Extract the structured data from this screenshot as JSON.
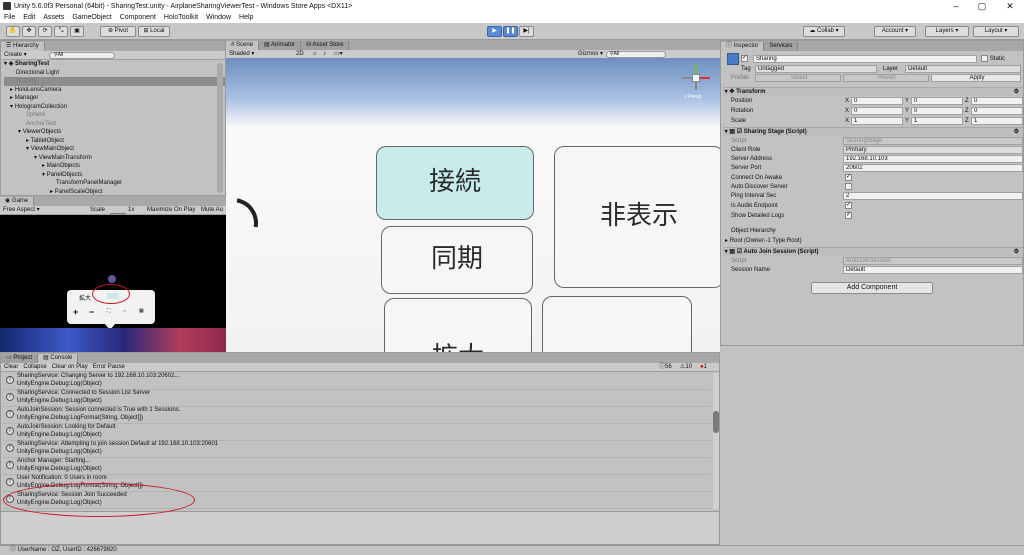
{
  "window": {
    "title": "Unity 5.6.0f3 Personal (64bit) - SharingTest.unity - AirplaneSharingViewerTest - Windows Store Apps <DX11>"
  },
  "menu": [
    "File",
    "Edit",
    "Assets",
    "GameObject",
    "Component",
    "HoloToolkit",
    "Window",
    "Help"
  ],
  "toolbar": {
    "pivot": "Pivot",
    "local": "Local",
    "collab": "Collab",
    "account": "Account",
    "layers": "Layers",
    "layout": "Layout"
  },
  "hierarchy": {
    "tab": "Hierarchy",
    "create": "Create",
    "search": "All",
    "scene": "SharingTest",
    "items": [
      {
        "label": "Directional Light",
        "grey": false
      },
      {
        "label": "Sharing",
        "grey": true
      },
      {
        "label": "HoloLensCamera",
        "grey": false
      },
      {
        "label": "Manager",
        "grey": false
      },
      {
        "label": "HologramCollection",
        "grey": false
      },
      {
        "label": "Sphere",
        "grey": true
      },
      {
        "label": "AnchorText",
        "grey": true
      },
      {
        "label": "ViewerObjects",
        "grey": false
      },
      {
        "label": "TabletObject",
        "grey": false
      },
      {
        "label": "ViewMainObject",
        "grey": false
      },
      {
        "label": "ViewMainTransform",
        "grey": false
      },
      {
        "label": "MainObjects",
        "grey": false
      },
      {
        "label": "PanelObjects",
        "grey": false
      },
      {
        "label": "TransformPanelManager",
        "grey": false
      },
      {
        "label": "PanelScaleObject",
        "grey": false
      }
    ]
  },
  "scene": {
    "tabs": [
      "Scene",
      "Animator",
      "Asset Store"
    ],
    "shading": "Shaded",
    "mode2d": "2D",
    "gizmos": "Gizmos",
    "search": "All",
    "persp": "< Persp",
    "buttons": {
      "connect": "接続",
      "sync": "同期",
      "hide": "非表示",
      "zoom": "拡大"
    }
  },
  "game": {
    "tab": "Game",
    "aspect": "Free Aspect",
    "scale": "Scale",
    "scale_val": "1x",
    "maximize": "Maximize On Play",
    "mute": "Mute Au",
    "popup_label": "拡大",
    "popup_btns": [
      "+",
      "−"
    ]
  },
  "inspector": {
    "tabs": [
      "Inspector",
      "Services"
    ],
    "object_name": "Sharing",
    "static": "Static",
    "tag_label": "Tag",
    "tag": "Untagged",
    "layer_label": "Layer",
    "layer": "Default",
    "prefab": "Prefab",
    "select": "Select",
    "revert": "Revert",
    "apply": "Apply",
    "transform": {
      "title": "Transform",
      "rows": [
        {
          "label": "Position",
          "x": "0",
          "y": "0",
          "z": "0"
        },
        {
          "label": "Rotation",
          "x": "0",
          "y": "0",
          "z": "0"
        },
        {
          "label": "Scale",
          "x": "1",
          "y": "1",
          "z": "1"
        }
      ]
    },
    "sharing_stage": {
      "title": "Sharing Stage (Script)",
      "script_label": "Script",
      "script": "SharingStage",
      "client_role_label": "Client Role",
      "client_role": "Primary",
      "server_address_label": "Server Address",
      "server_address": "192.168.10.103",
      "server_port_label": "Server Port",
      "server_port": "20602",
      "connect_on_awake": "Connect On Awake",
      "auto_discover": "Auto Discover Server",
      "ping_label": "Ping Interval Sec",
      "ping": "2",
      "audio_endpoint": "Is Audio Endpoint",
      "show_logs": "Show Detailed Logs",
      "object_hierarchy": "Object Hierarchy",
      "root": "Root (Owner:-1 Type:Root)"
    },
    "auto_join": {
      "title": "Auto Join Session (Script)",
      "script_label": "Script",
      "script": "AutoJoinSession",
      "session_label": "Session Name",
      "session": "Default"
    },
    "add_component": "Add Component"
  },
  "console": {
    "tabs": [
      "Project",
      "Console"
    ],
    "buttons": [
      "Clear",
      "Collapse",
      "Clear on Play",
      "Error Pause"
    ],
    "counts": {
      "info": "56",
      "warn": "10",
      "error": "1"
    },
    "logs": [
      {
        "l1": "SharingService: Changing Server to 192.168.10.103:20602...",
        "l2": "UnityEngine.Debug:Log(Object)"
      },
      {
        "l1": "SharingService: Connected to Session List Server",
        "l2": "UnityEngine.Debug:Log(Object)"
      },
      {
        "l1": "AutoJoinSession: Session connected is True with 1 Sessions.",
        "l2": "UnityEngine.Debug:LogFormat(String, Object[])"
      },
      {
        "l1": "AutoJoinSession: Looking for Default",
        "l2": "UnityEngine.Debug:Log(Object)"
      },
      {
        "l1": "SharingService: Attempting to join session Default at 192.168.10.103:20601",
        "l2": "UnityEngine.Debug:Log(Object)"
      },
      {
        "l1": "Anchor Manager: Starting...",
        "l2": "UnityEngine.Debug:Log(Object)"
      },
      {
        "l1": "User Notification: 0 Users in room",
        "l2": "UnityEngine.Debug:LogFormat(String, Object[])"
      },
      {
        "l1": "SharingService: Session Join Succeeded",
        "l2": "UnityEngine.Debug:Log(Object)"
      }
    ]
  },
  "status": "UserName : OZ, UserID : 426679820"
}
